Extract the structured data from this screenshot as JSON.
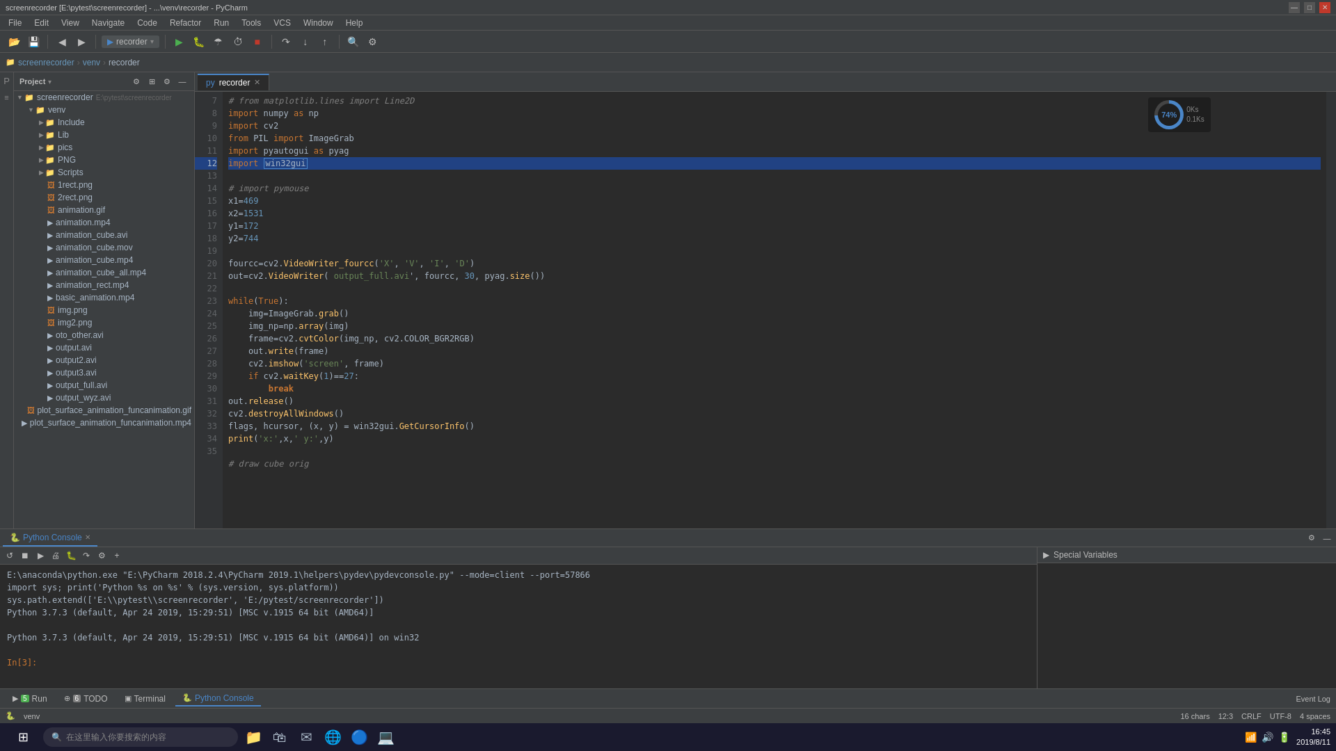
{
  "titlebar": {
    "title": "screenrecorder [E:\\pytest\\screenrecorder] - ...\\venv\\recorder - PyCharm",
    "controls": [
      "minimize",
      "maximize",
      "close"
    ]
  },
  "menubar": {
    "items": [
      "File",
      "Edit",
      "View",
      "Navigate",
      "Code",
      "Refactor",
      "Run",
      "Tools",
      "VCS",
      "Window",
      "Help"
    ]
  },
  "toolbar": {
    "project_dropdown": "recorder",
    "breadcrumb": {
      "root": "screenrecorder",
      "venv": "venv",
      "file": "recorder"
    }
  },
  "sidebar": {
    "title": "Project",
    "root": "screenrecorder",
    "root_path": "E:\\pytest\\screenrecorder",
    "tree": [
      {
        "id": "venv",
        "label": "venv",
        "type": "folder",
        "indent": 1,
        "expanded": true
      },
      {
        "id": "include",
        "label": "Include",
        "type": "folder",
        "indent": 2,
        "expanded": false
      },
      {
        "id": "lib",
        "label": "Lib",
        "type": "folder",
        "indent": 2,
        "expanded": false
      },
      {
        "id": "pics",
        "label": "pics",
        "type": "folder",
        "indent": 2,
        "expanded": false
      },
      {
        "id": "png",
        "label": "PNG",
        "type": "folder",
        "indent": 2,
        "expanded": false
      },
      {
        "id": "scripts",
        "label": "Scripts",
        "type": "folder",
        "indent": 2,
        "expanded": false
      },
      {
        "id": "1rect",
        "label": "1rect.png",
        "type": "img",
        "indent": 2
      },
      {
        "id": "2rect",
        "label": "2rect.png",
        "type": "img",
        "indent": 2
      },
      {
        "id": "animgif",
        "label": "animation.gif",
        "type": "img",
        "indent": 2
      },
      {
        "id": "animmp4",
        "label": "animation.mp4",
        "type": "file",
        "indent": 2
      },
      {
        "id": "animcubeavi",
        "label": "animation_cube.avi",
        "type": "file",
        "indent": 2
      },
      {
        "id": "animcubemov",
        "label": "animation_cube.mov",
        "type": "file",
        "indent": 2
      },
      {
        "id": "animcubemp4",
        "label": "animation_cube.mp4",
        "type": "file",
        "indent": 2
      },
      {
        "id": "animcubeallmp4",
        "label": "animation_cube_all.mp4",
        "type": "file",
        "indent": 2
      },
      {
        "id": "animrectmp4",
        "label": "animation_rect.mp4",
        "type": "file",
        "indent": 2
      },
      {
        "id": "basicanimmp4",
        "label": "basic_animation.mp4",
        "type": "file",
        "indent": 2
      },
      {
        "id": "imgpng",
        "label": "img.png",
        "type": "img",
        "indent": 2
      },
      {
        "id": "img2png",
        "label": "img2.png",
        "type": "img",
        "indent": 2
      },
      {
        "id": "otoother",
        "label": "oto_other.avi",
        "type": "file",
        "indent": 2
      },
      {
        "id": "outputavi",
        "label": "output.avi",
        "type": "file",
        "indent": 2
      },
      {
        "id": "output2avi",
        "label": "output2.avi",
        "type": "file",
        "indent": 2
      },
      {
        "id": "output3avi",
        "label": "output3.avi",
        "type": "file",
        "indent": 2
      },
      {
        "id": "outputfullavi",
        "label": "output_full.avi",
        "type": "file",
        "indent": 2
      },
      {
        "id": "outputwyzavi",
        "label": "output_wyz.avi",
        "type": "file",
        "indent": 2
      },
      {
        "id": "plotsurface",
        "label": "plot_surface_animation_funcanimation.gif",
        "type": "img",
        "indent": 2
      },
      {
        "id": "plotsurfacemp4",
        "label": "plot_surface_animation_funcanimation.mp4",
        "type": "file",
        "indent": 2
      }
    ]
  },
  "editor": {
    "tab_label": "recorder",
    "filename": "recorder.py",
    "lines": [
      {
        "num": 7,
        "code": "# from matplotlib.lines import Line2D",
        "type": "comment"
      },
      {
        "num": 8,
        "code": "import numpy as np",
        "type": "code"
      },
      {
        "num": 9,
        "code": "import cv2",
        "type": "code"
      },
      {
        "num": 10,
        "code": "from PIL import ImageGrab",
        "type": "code"
      },
      {
        "num": 11,
        "code": "import pyautogui as pyag",
        "type": "code"
      },
      {
        "num": 12,
        "code": "import win32gui",
        "type": "code_selected"
      },
      {
        "num": 13,
        "code": "# import pymouse",
        "type": "comment"
      },
      {
        "num": 14,
        "code": "x1=469",
        "type": "code"
      },
      {
        "num": 15,
        "code": "x2=1531",
        "type": "code"
      },
      {
        "num": 16,
        "code": "y1=172",
        "type": "code"
      },
      {
        "num": 17,
        "code": "y2=744",
        "type": "code"
      },
      {
        "num": 18,
        "code": "",
        "type": "empty"
      },
      {
        "num": 19,
        "code": "fourcc=cv2.VideoWriter_fourcc('X', 'V', 'I', 'D')",
        "type": "code"
      },
      {
        "num": 20,
        "code": "out=cv2.VideoWriter( output_full.avi', fourcc, 30, pyag.size())",
        "type": "code"
      },
      {
        "num": 21,
        "code": "",
        "type": "empty"
      },
      {
        "num": 22,
        "code": "while(True):",
        "type": "code"
      },
      {
        "num": 23,
        "code": "    img=ImageGrab.grab()",
        "type": "code"
      },
      {
        "num": 24,
        "code": "    img_np=np.array(img)",
        "type": "code"
      },
      {
        "num": 25,
        "code": "    frame=cv2.cvtColor(img_np, cv2.COLOR_BGR2RGB)",
        "type": "code"
      },
      {
        "num": 26,
        "code": "    out.write(frame)",
        "type": "code"
      },
      {
        "num": 27,
        "code": "    cv2.imshow('screen', frame)",
        "type": "code"
      },
      {
        "num": 28,
        "code": "    if cv2.waitKey(1)==27:",
        "type": "code"
      },
      {
        "num": 29,
        "code": "        break",
        "type": "code"
      },
      {
        "num": 30,
        "code": "out.release()",
        "type": "code"
      },
      {
        "num": 31,
        "code": "cv2.destroyAllWindows()",
        "type": "code"
      },
      {
        "num": 32,
        "code": "flags, hcursor, (x, y) = win32gui.GetCursorInfo()",
        "type": "code"
      },
      {
        "num": 33,
        "code": "print('x:', x, ' y:', y)",
        "type": "code"
      },
      {
        "num": 34,
        "code": "",
        "type": "empty"
      },
      {
        "num": 35,
        "code": "# draw cube orig",
        "type": "comment"
      }
    ]
  },
  "console": {
    "tab_label": "Python Console",
    "close_visible": true,
    "output": [
      {
        "type": "cmd",
        "text": "E:\\anaconda\\python.exe \"E:\\PyCharm 2018.2.4\\PyCharm 2019.1\\helpers\\pydev\\pydevconsole.py\" --mode=client --port=57866"
      },
      {
        "type": "code",
        "text": "import sys; print('Python %s on %s' % (sys.version, sys.platform))"
      },
      {
        "type": "code",
        "text": "sys.path.extend(['E:\\\\pytest\\\\screenrecorder', 'E:/pytest/screenrecorder'])"
      },
      {
        "type": "output",
        "text": "Python 3.7.3 (default, Apr 24 2019, 15:29:51) [MSC v.1915 64 bit (AMD64)]"
      },
      {
        "type": "output",
        "text": ""
      },
      {
        "type": "output",
        "text": "Python 3.7.3 (default, Apr 24 2019, 15:29:51) [MSC v.1915 64 bit (AMD64)] on win32"
      },
      {
        "type": "output",
        "text": ""
      },
      {
        "type": "prompt",
        "text": "In[3]:"
      }
    ]
  },
  "special_vars": {
    "title": "Special Variables"
  },
  "statusbar": {
    "chars": "16 chars",
    "position": "12:3",
    "line_ending": "CRLF",
    "encoding": "UTF-8",
    "indent": "4 spaces"
  },
  "run_bar": {
    "tabs": [
      {
        "label": "Run",
        "icon": "▶",
        "number": "5"
      },
      {
        "label": "TODO",
        "icon": "⊕",
        "number": "6"
      },
      {
        "label": "Terminal",
        "icon": "▣"
      },
      {
        "label": "Python Console",
        "icon": "🐍",
        "active": true
      }
    ]
  },
  "cpu_widget": {
    "percent": 74,
    "label": "74%",
    "stat1": "0Ks",
    "stat2": "0.1Ks"
  },
  "taskbar": {
    "search_placeholder": "在这里输入你要搜索的内容",
    "time": "16:45",
    "date": "2019/8/11"
  }
}
